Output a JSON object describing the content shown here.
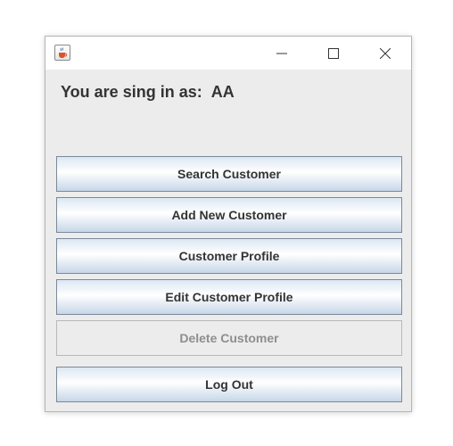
{
  "window": {
    "icon": "java-coffee-cup-icon",
    "controls": [
      "minimize-icon",
      "maximize-icon",
      "close-icon"
    ]
  },
  "signin": {
    "label": "You are sing in as:",
    "username": "AA"
  },
  "buttons": {
    "search": "Search Customer",
    "add_new": "Add New Customer",
    "profile": "Customer Profile",
    "edit_profile": "Edit Customer Profile",
    "delete": "Delete Customer",
    "logout": "Log Out"
  },
  "colors": {
    "window_bg": "#ececec",
    "button_border": "#7a8a99",
    "button_gradient_top": "#dce7f3",
    "button_gradient_bottom": "#c6d6e8",
    "text": "#333333",
    "disabled_text": "#8e8e8e"
  }
}
